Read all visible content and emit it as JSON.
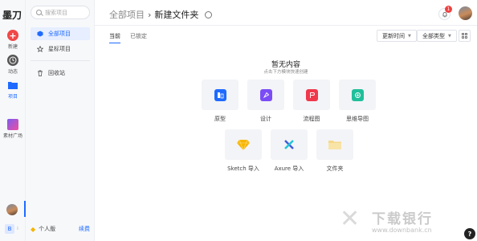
{
  "app": {
    "logo": "墨刀"
  },
  "rail": {
    "items": [
      {
        "label": "新建",
        "icon": "plus-icon"
      },
      {
        "label": "动态",
        "icon": "clock-icon"
      },
      {
        "label": "项目",
        "icon": "folder-icon"
      },
      {
        "label": "素材广场",
        "icon": "material-icon"
      }
    ],
    "team_chip": "B",
    "team_dot": "⁞"
  },
  "sidebar": {
    "search_placeholder": "搜索项目",
    "items": [
      {
        "label": "全部项目",
        "icon": "cube-icon"
      },
      {
        "label": "星标项目",
        "icon": "star-icon"
      },
      {
        "label": "回收站",
        "icon": "trash-icon"
      }
    ],
    "plan": {
      "label": "个人版",
      "renew": "续费"
    }
  },
  "header": {
    "breadcrumb_root": "全部项目",
    "separator": "›",
    "breadcrumb_current": "新建文件夹",
    "notification_count": "1"
  },
  "toolbar": {
    "tabs": [
      {
        "label": "当前"
      },
      {
        "label": "已锁定"
      }
    ],
    "sort_label": "更新时间",
    "type_label": "全部类型"
  },
  "empty": {
    "title": "暂无内容",
    "subtitle": "点击下方模块快速创建"
  },
  "create_cards": [
    {
      "label": "原型",
      "icon": "prototype-icon",
      "color": "#1f6bff"
    },
    {
      "label": "设计",
      "icon": "design-icon",
      "color": "#7b4cf5"
    },
    {
      "label": "流程图",
      "icon": "flowchart-icon",
      "color": "#f0384c"
    },
    {
      "label": "思维导图",
      "icon": "mindmap-icon",
      "color": "#1fbf9a"
    },
    {
      "label": "Sketch 导入",
      "icon": "sketch-icon",
      "color": "#f7b500"
    },
    {
      "label": "Axure 导入",
      "icon": "axure-icon",
      "color": "#3f5bd8"
    },
    {
      "label": "文件夹",
      "icon": "folder-icon",
      "color": "#f5d98a"
    }
  ],
  "watermark": {
    "title": "下载银行",
    "url": "www.downbank.cn"
  },
  "help_label": "?"
}
